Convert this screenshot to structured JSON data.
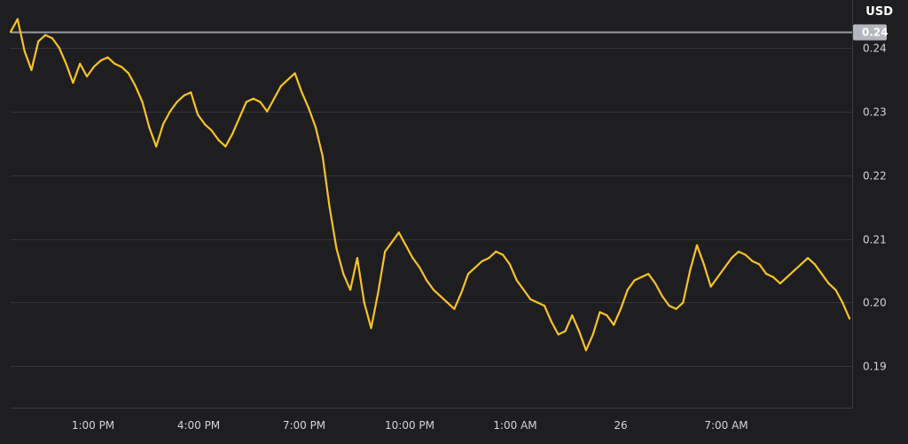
{
  "chart_data": {
    "type": "line",
    "unit": "USD",
    "current_value_label": "0.24",
    "current_value": 0.2425,
    "ylim": [
      0.1835,
      0.2475
    ],
    "y_ticks": [
      {
        "value": 0.24,
        "label": "0.24"
      },
      {
        "value": 0.23,
        "label": "0.23"
      },
      {
        "value": 0.22,
        "label": "0.22"
      },
      {
        "value": 0.21,
        "label": "0.21"
      },
      {
        "value": 0.2,
        "label": "0.20"
      },
      {
        "value": 0.19,
        "label": "0.19"
      }
    ],
    "x_ticks": [
      "1:00 PM",
      "4:00 PM",
      "7:00 PM",
      "10:00 PM",
      "1:00 AM",
      "26",
      "7:00 AM"
    ],
    "grid": true,
    "line_color": "#f7c325",
    "series": [
      {
        "values": [
          0.2425,
          0.2445,
          0.2395,
          0.2365,
          0.241,
          0.242,
          0.2415,
          0.24,
          0.2375,
          0.2345,
          0.2375,
          0.2355,
          0.237,
          0.238,
          0.2385,
          0.2375,
          0.237,
          0.236,
          0.234,
          0.2315,
          0.2275,
          0.2245,
          0.228,
          0.23,
          0.2315,
          0.2325,
          0.233,
          0.2295,
          0.228,
          0.227,
          0.2255,
          0.2245,
          0.2265,
          0.229,
          0.2315,
          0.232,
          0.2315,
          0.23,
          0.232,
          0.234,
          0.235,
          0.236,
          0.233,
          0.2305,
          0.2275,
          0.223,
          0.215,
          0.2085,
          0.2045,
          0.202,
          0.207,
          0.2,
          0.196,
          0.2015,
          0.208,
          0.2095,
          0.211,
          0.209,
          0.207,
          0.2055,
          0.2035,
          0.202,
          0.201,
          0.2,
          0.199,
          0.2015,
          0.2045,
          0.2055,
          0.2065,
          0.207,
          0.208,
          0.2075,
          0.206,
          0.2035,
          0.202,
          0.2005,
          0.2,
          0.1995,
          0.197,
          0.195,
          0.1955,
          0.198,
          0.1955,
          0.1925,
          0.195,
          0.1985,
          0.198,
          0.1965,
          0.199,
          0.202,
          0.2035,
          0.204,
          0.2045,
          0.203,
          0.201,
          0.1995,
          0.199,
          0.2,
          0.205,
          0.209,
          0.206,
          0.2025,
          0.204,
          0.2055,
          0.207,
          0.208,
          0.2075,
          0.2065,
          0.206,
          0.2045,
          0.204,
          0.203,
          0.204,
          0.205,
          0.206,
          0.207,
          0.206,
          0.2045,
          0.203,
          0.202,
          0.2,
          0.1975
        ]
      }
    ]
  }
}
